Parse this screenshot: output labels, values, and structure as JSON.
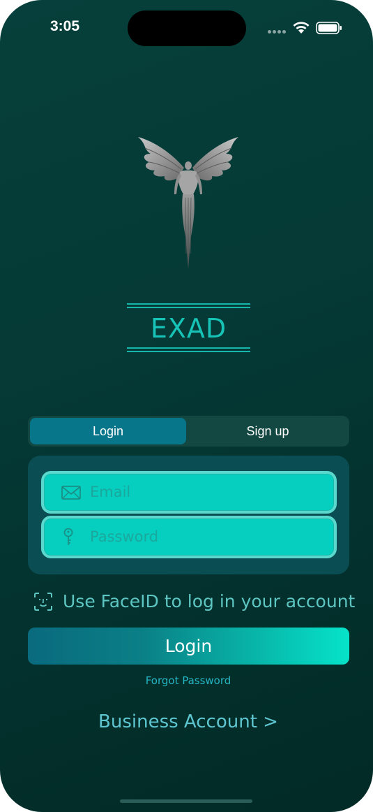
{
  "status_bar": {
    "time": "3:05"
  },
  "brand": {
    "title": "EXAD",
    "logo_icon": "winged-figure-icon"
  },
  "segment": {
    "login_label": "Login",
    "signup_label": "Sign up",
    "selected": "Login"
  },
  "form": {
    "email_placeholder": "Email",
    "password_placeholder": "Password",
    "email_icon": "envelope-icon",
    "password_icon": "key-icon"
  },
  "faceid": {
    "label": "Use FaceID to log in your account",
    "icon": "faceid-icon"
  },
  "actions": {
    "login_label": "Login",
    "forgot_label": "Forgot Password",
    "business_label": "Business Account >"
  },
  "colors": {
    "background": "#053a36",
    "accent": "#17c3b6",
    "field": "#07cfc0",
    "segment_selected": "#07768a"
  }
}
